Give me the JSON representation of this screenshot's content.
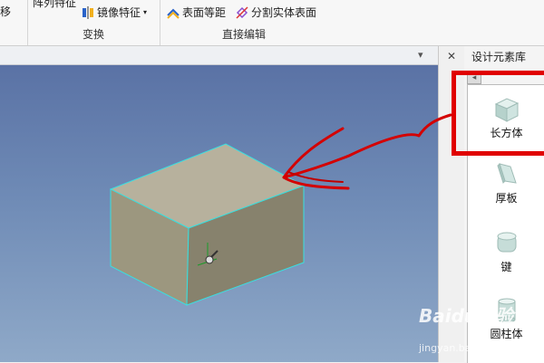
{
  "ribbon": {
    "left_button": "移",
    "pattern_feature": "阵列特征",
    "mirror_feature": "镜像特征",
    "transform_group": "变换",
    "offset_surface": "表面等距",
    "split_solid_surface": "分割实体表面",
    "direct_edit_group": "直接编辑"
  },
  "doc_tabs": {
    "dropdown_glyph": "▾",
    "close_glyph": "✕"
  },
  "panel": {
    "title": "设计元素库",
    "back_glyph": "◂",
    "items": [
      {
        "label": "长方体",
        "icon": "cuboid-icon"
      },
      {
        "label": "厚板",
        "icon": "thick-plate-icon"
      },
      {
        "label": "键",
        "icon": "key-icon"
      },
      {
        "label": "圆柱体",
        "icon": "cylinder-icon"
      }
    ]
  },
  "watermark": {
    "brand": "Baidu经验",
    "url": "jingyan.baidu.com"
  },
  "colors": {
    "accent": "#e00000",
    "edge_highlight": "#38e0e0",
    "box_face": "#b6b09c"
  }
}
